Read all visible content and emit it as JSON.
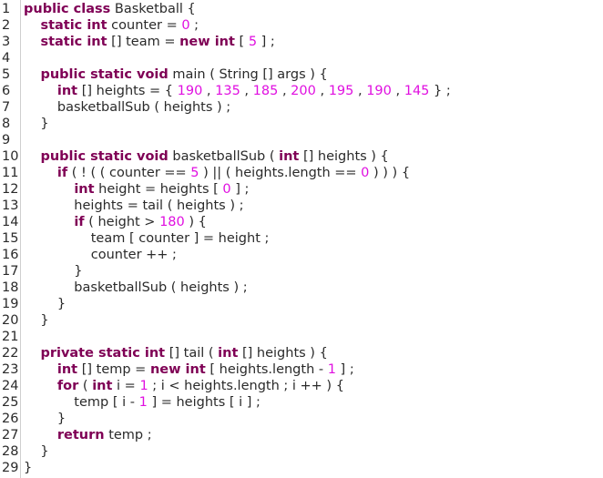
{
  "colors": {
    "keyword": "#7f0055",
    "number": "#e00fe0",
    "text": "#2a2a2a",
    "background": "#ffffff"
  },
  "lines": [
    {
      "n": "1",
      "tokens": [
        [
          "k",
          "public class"
        ],
        [
          "t",
          " Basketball {"
        ]
      ]
    },
    {
      "n": "2",
      "tokens": [
        [
          "t",
          "    "
        ],
        [
          "k",
          "static int"
        ],
        [
          "t",
          " counter = "
        ],
        [
          "n",
          "0"
        ],
        [
          "t",
          " ;"
        ]
      ]
    },
    {
      "n": "3",
      "tokens": [
        [
          "t",
          "    "
        ],
        [
          "k",
          "static int"
        ],
        [
          "t",
          " [] team = "
        ],
        [
          "k",
          "new int"
        ],
        [
          "t",
          " [ "
        ],
        [
          "n",
          "5"
        ],
        [
          "t",
          " ] ;"
        ]
      ]
    },
    {
      "n": "4",
      "tokens": []
    },
    {
      "n": "5",
      "tokens": [
        [
          "t",
          "    "
        ],
        [
          "k",
          "public static void"
        ],
        [
          "t",
          " main ( String [] args ) {"
        ]
      ]
    },
    {
      "n": "6",
      "tokens": [
        [
          "t",
          "        "
        ],
        [
          "k",
          "int"
        ],
        [
          "t",
          " [] heights = { "
        ],
        [
          "n",
          "190"
        ],
        [
          "t",
          " , "
        ],
        [
          "n",
          "135"
        ],
        [
          "t",
          " , "
        ],
        [
          "n",
          "185"
        ],
        [
          "t",
          " , "
        ],
        [
          "n",
          "200"
        ],
        [
          "t",
          " , "
        ],
        [
          "n",
          "195"
        ],
        [
          "t",
          " , "
        ],
        [
          "n",
          "190"
        ],
        [
          "t",
          " , "
        ],
        [
          "n",
          "145"
        ],
        [
          "t",
          " } ;"
        ]
      ]
    },
    {
      "n": "7",
      "tokens": [
        [
          "t",
          "        basketballSub ( heights ) ;"
        ]
      ]
    },
    {
      "n": "8",
      "tokens": [
        [
          "t",
          "    }"
        ]
      ]
    },
    {
      "n": "9",
      "tokens": []
    },
    {
      "n": "10",
      "tokens": [
        [
          "t",
          "    "
        ],
        [
          "k",
          "public static void"
        ],
        [
          "t",
          " basketballSub ( "
        ],
        [
          "k",
          "int"
        ],
        [
          "t",
          " [] heights ) {"
        ]
      ]
    },
    {
      "n": "11",
      "tokens": [
        [
          "t",
          "        "
        ],
        [
          "k",
          "if"
        ],
        [
          "t",
          " ( ! ( ( counter == "
        ],
        [
          "n",
          "5"
        ],
        [
          "t",
          " ) || ( heights.length == "
        ],
        [
          "n",
          "0"
        ],
        [
          "t",
          " ) ) ) {"
        ]
      ]
    },
    {
      "n": "12",
      "tokens": [
        [
          "t",
          "            "
        ],
        [
          "k",
          "int"
        ],
        [
          "t",
          " height = heights [ "
        ],
        [
          "n",
          "0"
        ],
        [
          "t",
          " ] ;"
        ]
      ]
    },
    {
      "n": "13",
      "tokens": [
        [
          "t",
          "            heights = tail ( heights ) ;"
        ]
      ]
    },
    {
      "n": "14",
      "tokens": [
        [
          "t",
          "            "
        ],
        [
          "k",
          "if"
        ],
        [
          "t",
          " ( height > "
        ],
        [
          "n",
          "180"
        ],
        [
          "t",
          " ) {"
        ]
      ]
    },
    {
      "n": "15",
      "tokens": [
        [
          "t",
          "                team [ counter ] = height ;"
        ]
      ]
    },
    {
      "n": "16",
      "tokens": [
        [
          "t",
          "                counter ++ ;"
        ]
      ]
    },
    {
      "n": "17",
      "tokens": [
        [
          "t",
          "            }"
        ]
      ]
    },
    {
      "n": "18",
      "tokens": [
        [
          "t",
          "            basketballSub ( heights ) ;"
        ]
      ]
    },
    {
      "n": "19",
      "tokens": [
        [
          "t",
          "        }"
        ]
      ]
    },
    {
      "n": "20",
      "tokens": [
        [
          "t",
          "    }"
        ]
      ]
    },
    {
      "n": "21",
      "tokens": []
    },
    {
      "n": "22",
      "tokens": [
        [
          "t",
          "    "
        ],
        [
          "k",
          "private static int"
        ],
        [
          "t",
          " [] tail ( "
        ],
        [
          "k",
          "int"
        ],
        [
          "t",
          " [] heights ) {"
        ]
      ]
    },
    {
      "n": "23",
      "tokens": [
        [
          "t",
          "        "
        ],
        [
          "k",
          "int"
        ],
        [
          "t",
          " [] temp = "
        ],
        [
          "k",
          "new int"
        ],
        [
          "t",
          " [ heights.length - "
        ],
        [
          "n",
          "1"
        ],
        [
          "t",
          " ] ;"
        ]
      ]
    },
    {
      "n": "24",
      "tokens": [
        [
          "t",
          "        "
        ],
        [
          "k",
          "for"
        ],
        [
          "t",
          " ( "
        ],
        [
          "k",
          "int"
        ],
        [
          "t",
          " i = "
        ],
        [
          "n",
          "1"
        ],
        [
          "t",
          " ; i < heights.length ; i ++ ) {"
        ]
      ]
    },
    {
      "n": "25",
      "tokens": [
        [
          "t",
          "            temp [ i - "
        ],
        [
          "n",
          "1"
        ],
        [
          "t",
          " ] = heights [ i ] ;"
        ]
      ]
    },
    {
      "n": "26",
      "tokens": [
        [
          "t",
          "        }"
        ]
      ]
    },
    {
      "n": "27",
      "tokens": [
        [
          "t",
          "        "
        ],
        [
          "k",
          "return"
        ],
        [
          "t",
          " temp ;"
        ]
      ]
    },
    {
      "n": "28",
      "tokens": [
        [
          "t",
          "    }"
        ]
      ]
    },
    {
      "n": "29",
      "tokens": [
        [
          "t",
          "}"
        ]
      ]
    }
  ]
}
